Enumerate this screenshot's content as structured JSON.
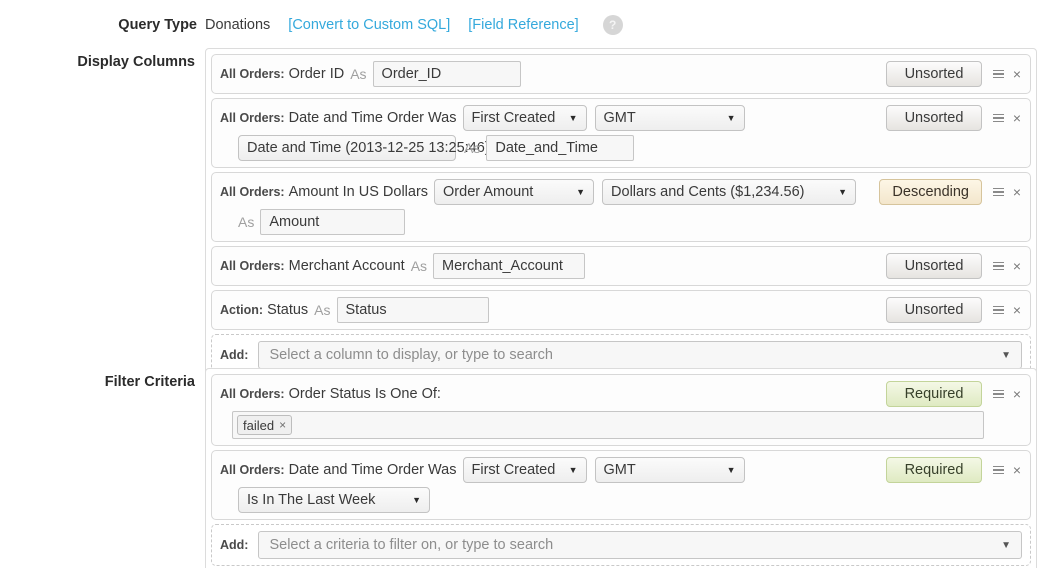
{
  "header": {
    "query_type_label": "Query Type",
    "query_type_value": "Donations",
    "convert_link": "[Convert to Custom SQL]",
    "field_reference_link": "[Field Reference]",
    "help_icon": "?"
  },
  "display_columns": {
    "label": "Display Columns",
    "rows": [
      {
        "source": "All Orders:",
        "field": "Order ID",
        "as_word": "As",
        "alias": "Order_ID",
        "sort": "Unsorted",
        "sort_state": "inactive"
      },
      {
        "source": "All Orders:",
        "field": "Date and Time Order Was",
        "event_select": "First Created",
        "timezone_select": "GMT",
        "format_select": "Date and Time (2013-12-25 13:25:46)",
        "as_word": "As",
        "alias": "Date_and_Time",
        "sort": "Unsorted",
        "sort_state": "inactive"
      },
      {
        "source": "All Orders:",
        "field": "Amount In US Dollars",
        "amount_select": "Order Amount",
        "format_select": "Dollars and Cents ($1,234.56)",
        "as_word": "As",
        "alias": "Amount",
        "sort": "Descending",
        "sort_state": "active"
      },
      {
        "source": "All Orders:",
        "field": "Merchant Account",
        "as_word": "As",
        "alias": "Merchant_Account",
        "sort": "Unsorted",
        "sort_state": "inactive"
      },
      {
        "source": "Action:",
        "field": "Status",
        "as_word": "As",
        "alias": "Status",
        "sort": "Unsorted",
        "sort_state": "inactive"
      }
    ],
    "add_label": "Add:",
    "add_placeholder": "Select a column to display, or type to search"
  },
  "filter_criteria": {
    "label": "Filter Criteria",
    "rows": [
      {
        "source": "All Orders:",
        "field": "Order Status Is One Of:",
        "tokens": [
          {
            "text": "failed",
            "remove": "×"
          }
        ],
        "state": "Required"
      },
      {
        "source": "All Orders:",
        "field": "Date and Time Order Was",
        "event_select": "First Created",
        "timezone_select": "GMT",
        "operator_select": "Is In The Last Week",
        "state": "Required"
      }
    ],
    "add_label": "Add:",
    "add_placeholder": "Select a criteria to filter on, or type to search"
  },
  "icons": {
    "caret_down": "▼",
    "close": "×"
  }
}
